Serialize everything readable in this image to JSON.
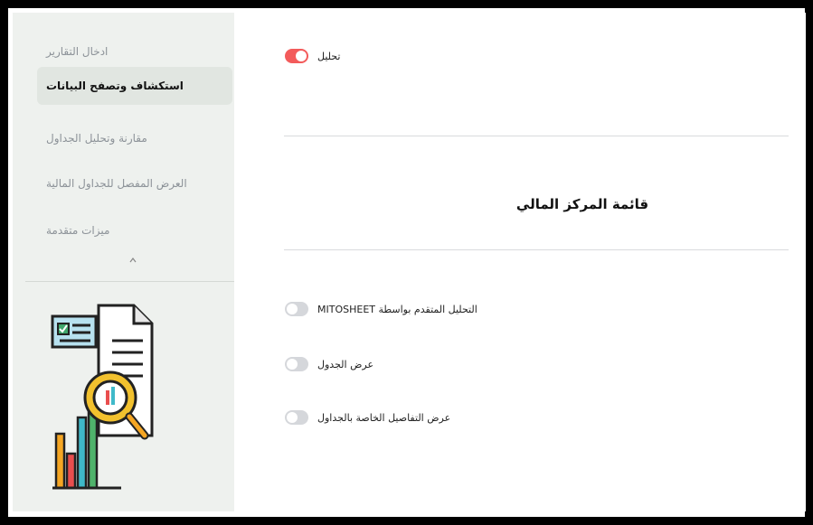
{
  "sidebar": {
    "items": [
      {
        "label": "ادخال التقارير",
        "active": false
      },
      {
        "label": "استكشاف وتصفح البيانات",
        "active": true
      },
      {
        "label": "مقارنة وتحليل الجداول",
        "active": false
      },
      {
        "label": "العرض المفصل للجداول المالية",
        "active": false
      },
      {
        "label": "ميزات متقدمة",
        "active": false
      }
    ],
    "collapse_icon": "chevron-up-icon",
    "illustration": "report-analysis-illustration"
  },
  "main": {
    "analysis_toggle": {
      "label": "تحليل",
      "checked": true
    },
    "section_title": "قائمة المركز المالي",
    "toggles": [
      {
        "label": "MITOSHEET التحليل المتقدم بواسطة",
        "checked": false
      },
      {
        "label": "عرض الجدول",
        "checked": false
      },
      {
        "label": "عرض التفاصيل الخاصة بالجداول",
        "checked": false
      }
    ]
  },
  "colors": {
    "sidebar_bg": "#eef1ee",
    "active_item_bg": "#e1e6e1",
    "toggle_on": "#f35b5b",
    "toggle_off": "#d5d7db"
  }
}
